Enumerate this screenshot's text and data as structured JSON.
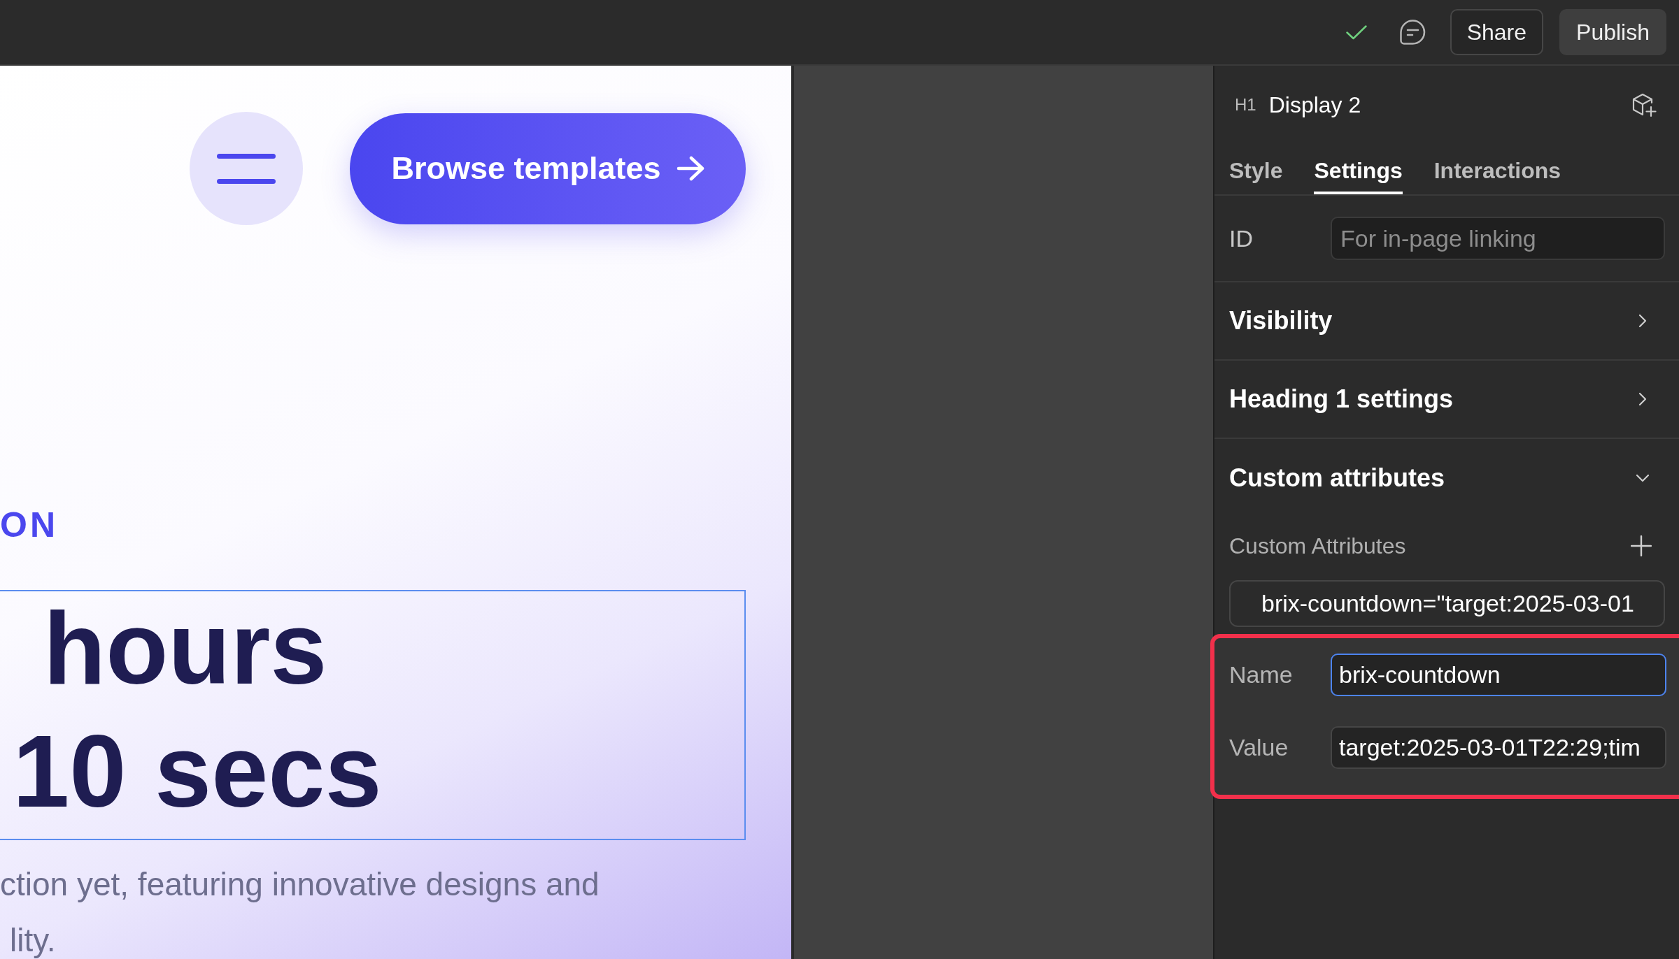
{
  "toolbar": {
    "buttons": [
      {
        "label": "Share",
        "kind": "outline"
      },
      {
        "label": "Publish",
        "kind": "filled"
      }
    ]
  },
  "canvas": {
    "cta_button": "Browse templates",
    "eyebrow": "ON",
    "heading": {
      "selected": true,
      "lines": [
        "hours",
        "10 secs"
      ]
    },
    "paragraph_lines": [
      "ction yet, featuring innovative designs and",
      "lity."
    ]
  },
  "panel": {
    "element": {
      "tag": "H1",
      "name": "Display 2"
    },
    "tabs": [
      {
        "label": "Style",
        "selected": false
      },
      {
        "label": "Settings",
        "selected": true
      },
      {
        "label": "Interactions",
        "selected": false
      }
    ],
    "id_field": {
      "label": "ID",
      "placeholder": "For in-page linking"
    },
    "sections": [
      {
        "title": "Visibility",
        "expanded": false
      },
      {
        "title": "Heading 1 settings",
        "expanded": false
      },
      {
        "title": "Custom attributes",
        "expanded": true,
        "list_label": "Custom Attributes",
        "attributes": [
          "brix-countdown=\"target:2025-03-01"
        ],
        "editor": {
          "highlighted": true,
          "fields": [
            {
              "label": "Name",
              "value": "brix-countdown",
              "focused": true
            },
            {
              "label": "Value",
              "value": "target:2025-03-01T22:29;tim",
              "focused": false
            }
          ]
        }
      }
    ]
  }
}
